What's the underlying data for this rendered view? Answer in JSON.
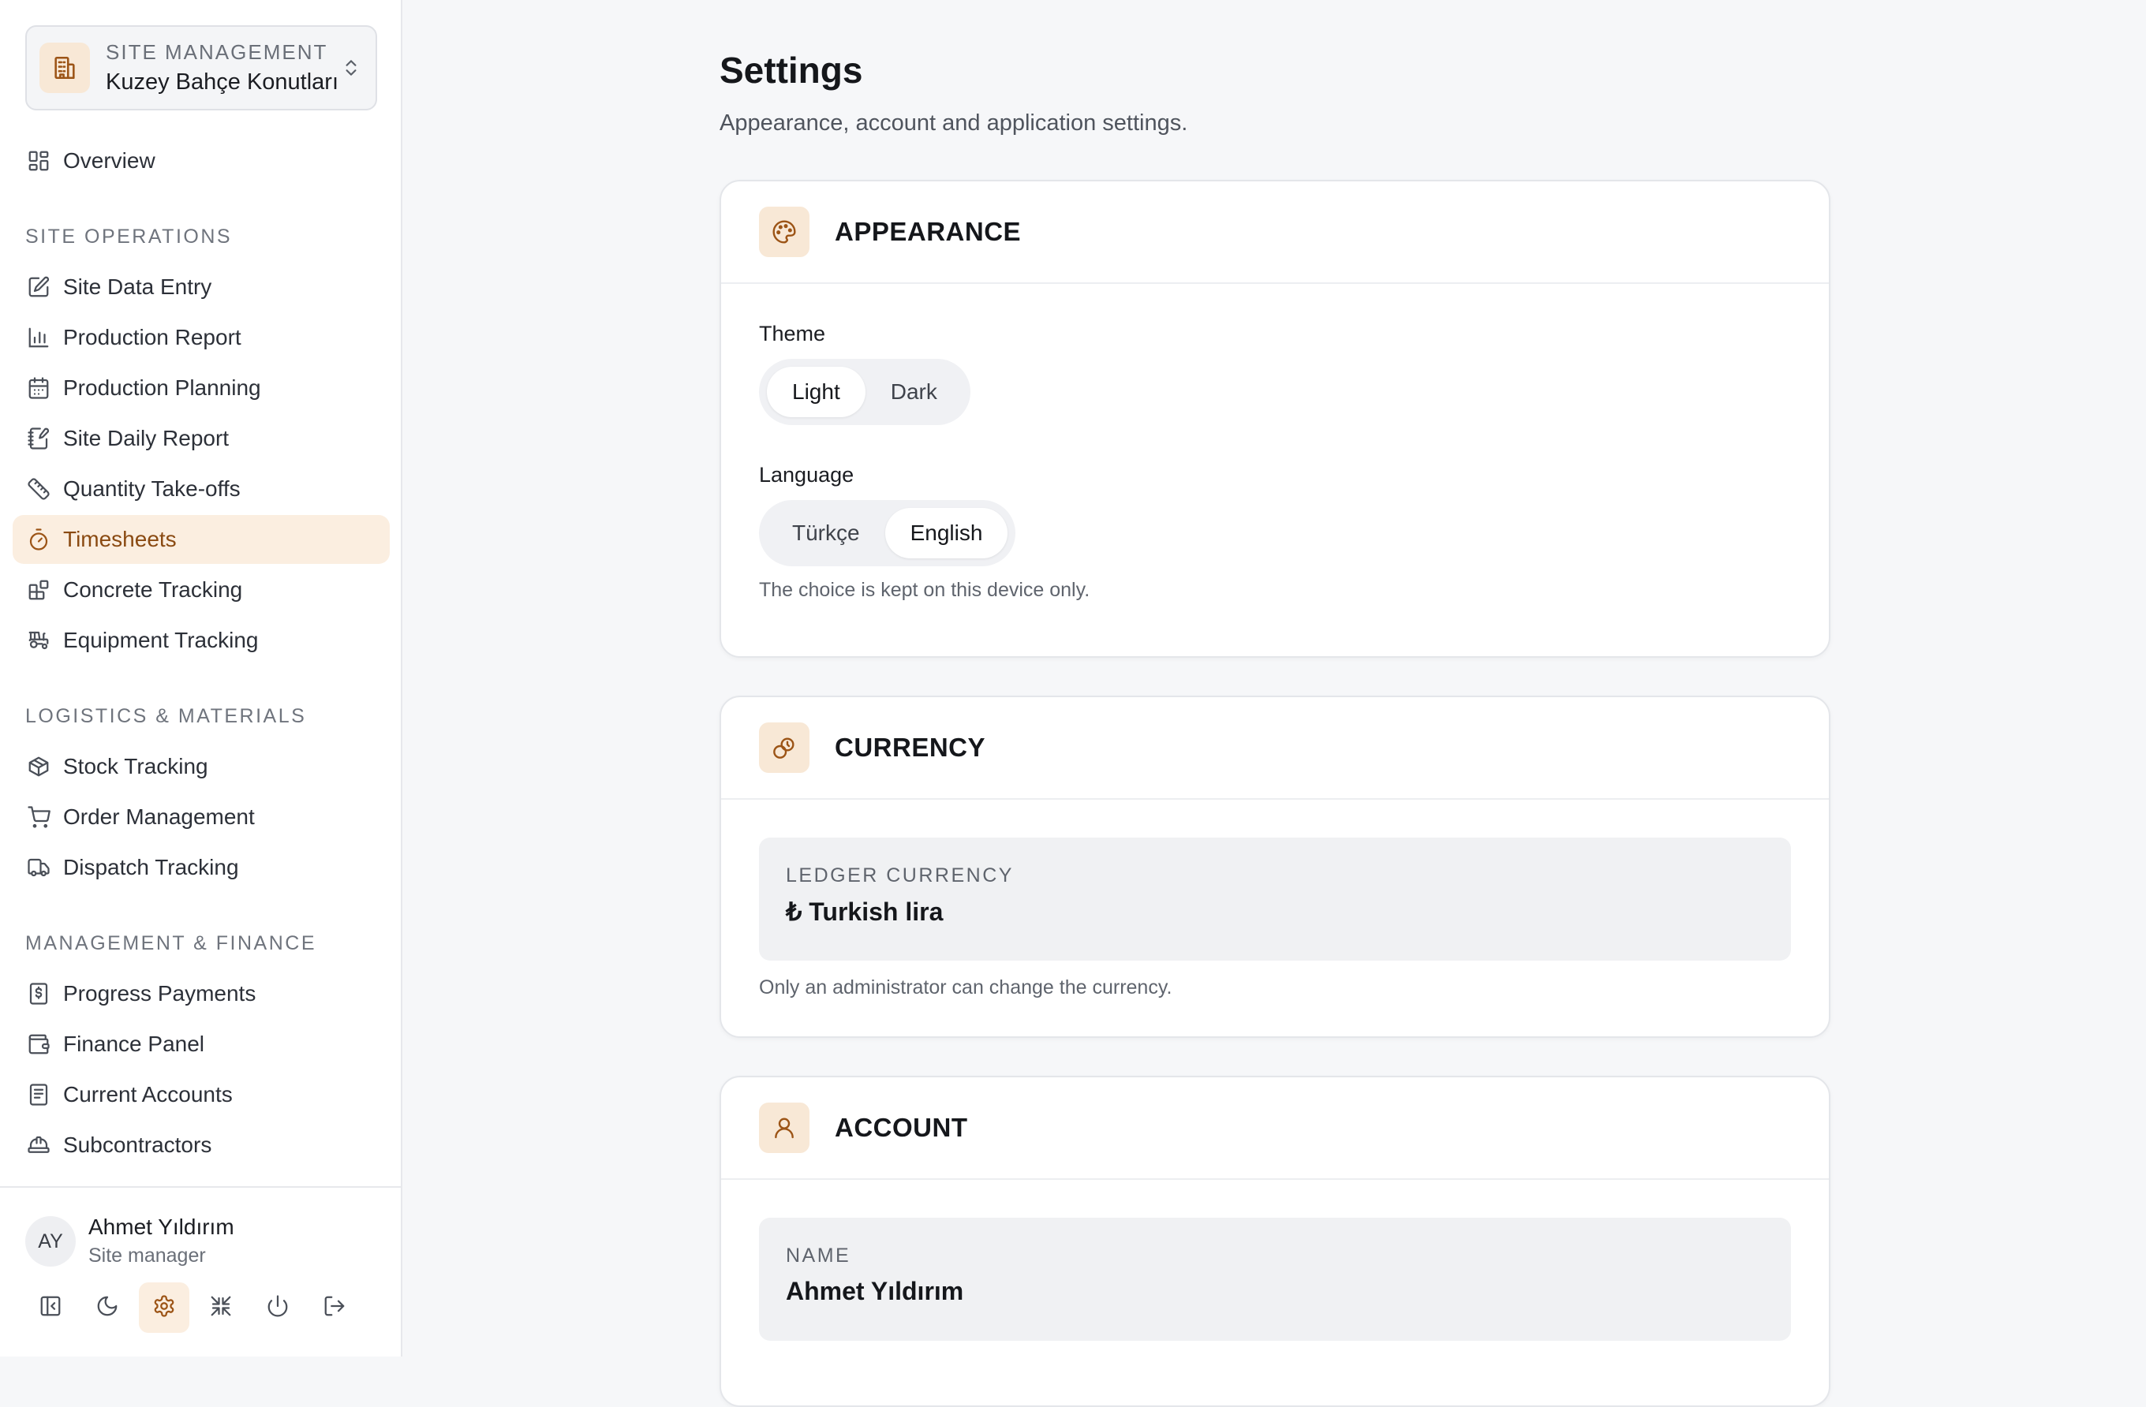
{
  "site_switcher": {
    "kicker": "SITE MANAGEMENT",
    "name": "Kuzey Bahçe Konutları"
  },
  "nav": {
    "overview": "Overview",
    "sections": [
      {
        "title": "SITE OPERATIONS",
        "items": [
          {
            "label": "Site Data Entry",
            "icon": "edit-icon"
          },
          {
            "label": "Production Report",
            "icon": "bar-chart-icon"
          },
          {
            "label": "Production Planning",
            "icon": "calendar-icon"
          },
          {
            "label": "Site Daily Report",
            "icon": "notebook-pen-icon"
          },
          {
            "label": "Quantity Take-offs",
            "icon": "ruler-icon"
          },
          {
            "label": "Timesheets",
            "icon": "stopwatch-icon",
            "active": true
          },
          {
            "label": "Concrete Tracking",
            "icon": "blocks-icon"
          },
          {
            "label": "Equipment Tracking",
            "icon": "tractor-icon"
          }
        ]
      },
      {
        "title": "LOGISTICS & MATERIALS",
        "items": [
          {
            "label": "Stock Tracking",
            "icon": "package-icon"
          },
          {
            "label": "Order Management",
            "icon": "cart-icon"
          },
          {
            "label": "Dispatch Tracking",
            "icon": "truck-icon"
          }
        ]
      },
      {
        "title": "MANAGEMENT & FINANCE",
        "items": [
          {
            "label": "Progress Payments",
            "icon": "dollar-receipt-icon"
          },
          {
            "label": "Finance Panel",
            "icon": "wallet-icon"
          },
          {
            "label": "Current Accounts",
            "icon": "ledger-icon"
          },
          {
            "label": "Subcontractors",
            "icon": "hard-hat-icon"
          }
        ]
      }
    ]
  },
  "user": {
    "initials": "AY",
    "name": "Ahmet Yıldırım",
    "role": "Site manager"
  },
  "footer_tools": [
    "collapse-sidebar-icon",
    "moon-icon",
    "gear-icon",
    "minimize-icon",
    "power-icon",
    "logout-icon"
  ],
  "page": {
    "title": "Settings",
    "subtitle": "Appearance, account and application settings."
  },
  "appearance": {
    "title": "APPEARANCE",
    "theme_label": "Theme",
    "theme_options": [
      "Light",
      "Dark"
    ],
    "theme_selected": "Light",
    "language_label": "Language",
    "language_options": [
      "Türkçe",
      "English"
    ],
    "language_selected": "English",
    "hint": "The choice is kept on this device only."
  },
  "currency": {
    "title": "CURRENCY",
    "kicker": "LEDGER CURRENCY",
    "value": "₺ Turkish lira",
    "hint": "Only an administrator can change the currency."
  },
  "account": {
    "title": "ACCOUNT",
    "name_kicker": "NAME",
    "name_value": "Ahmet Yıldırım"
  },
  "colors": {
    "accent": "#9c5416",
    "accent_bg": "#fbeee0"
  }
}
